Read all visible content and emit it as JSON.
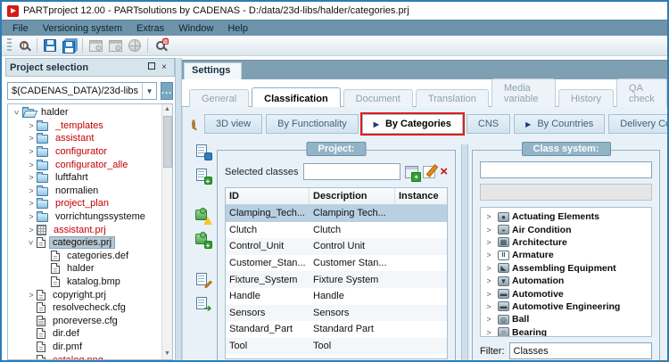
{
  "window": {
    "title": "PARTproject 12.00 - PARTsolutions by CADENAS - D:/data/23d-libs/halder/categories.prj"
  },
  "menubar": {
    "items": [
      {
        "label": "File"
      },
      {
        "label": "Versioning system"
      },
      {
        "label": "Extras"
      },
      {
        "label": "Window"
      },
      {
        "label": "Help"
      }
    ]
  },
  "toolbar": {
    "icons": [
      "search-text-icon",
      "save-icon",
      "save-all-icon",
      "project-window-icon",
      "project-window-settings-icon",
      "publish-globe-icon",
      "search-lock-icon"
    ]
  },
  "project_selection": {
    "title": "Project selection",
    "path_value": "$(CADENAS_DATA)/23d-libs",
    "browse_label": "...",
    "tree": [
      {
        "label": "halder",
        "depth": 0,
        "icon": "folder-open",
        "expander": "open",
        "color": "black",
        "selected": false
      },
      {
        "label": "_templates",
        "depth": 1,
        "icon": "folder",
        "expander": "closed",
        "color": "red",
        "selected": false
      },
      {
        "label": "assistant",
        "depth": 1,
        "icon": "folder",
        "expander": "closed",
        "color": "red",
        "selected": false
      },
      {
        "label": "configurator",
        "depth": 1,
        "icon": "folder",
        "expander": "closed",
        "color": "red",
        "selected": false
      },
      {
        "label": "configurator_alle",
        "depth": 1,
        "icon": "folder",
        "expander": "closed",
        "color": "red",
        "selected": false
      },
      {
        "label": "luftfahrt",
        "depth": 1,
        "icon": "folder",
        "expander": "closed",
        "color": "black",
        "selected": false
      },
      {
        "label": "normalien",
        "depth": 1,
        "icon": "folder",
        "expander": "closed",
        "color": "black",
        "selected": false
      },
      {
        "label": "project_plan",
        "depth": 1,
        "icon": "folder",
        "expander": "closed",
        "color": "red",
        "selected": false
      },
      {
        "label": "vorrichtungssysteme",
        "depth": 1,
        "icon": "folder",
        "expander": "closed",
        "color": "black",
        "selected": false
      },
      {
        "label": "assistant.prj",
        "depth": 1,
        "icon": "prj-grid",
        "expander": "closed",
        "color": "red",
        "selected": false
      },
      {
        "label": "categories.prj",
        "depth": 1,
        "icon": "file",
        "expander": "open",
        "color": "black",
        "selected": true
      },
      {
        "label": "categories.def",
        "depth": 2,
        "icon": "file",
        "expander": "none",
        "color": "black",
        "selected": false
      },
      {
        "label": "halder",
        "depth": 2,
        "icon": "file",
        "expander": "none",
        "color": "black",
        "selected": false
      },
      {
        "label": "katalog.bmp",
        "depth": 2,
        "icon": "file",
        "expander": "none",
        "color": "black",
        "selected": false
      },
      {
        "label": "copyright.prj",
        "depth": 1,
        "icon": "file",
        "expander": "closed",
        "color": "black",
        "selected": false
      },
      {
        "label": "resolvecheck.cfg",
        "depth": 1,
        "icon": "file",
        "expander": "none",
        "color": "black",
        "selected": false
      },
      {
        "label": "pnoreverse.cfg",
        "depth": 1,
        "icon": "file-lines",
        "expander": "none",
        "color": "black",
        "selected": false
      },
      {
        "label": "dir.def",
        "depth": 1,
        "icon": "file",
        "expander": "none",
        "color": "black",
        "selected": false
      },
      {
        "label": "dir.pmf",
        "depth": 1,
        "icon": "file",
        "expander": "none",
        "color": "black",
        "selected": false
      },
      {
        "label": "catalog.png",
        "depth": 1,
        "icon": "file",
        "expander": "none",
        "color": "red",
        "selected": false
      }
    ]
  },
  "settings": {
    "dock_tab_label": "Settings",
    "tabs": [
      {
        "label": "General",
        "active": false
      },
      {
        "label": "Classification",
        "active": true
      },
      {
        "label": "Document",
        "active": false
      },
      {
        "label": "Translation",
        "active": false
      },
      {
        "label": "Media variable",
        "active": false
      },
      {
        "label": "History",
        "active": false
      },
      {
        "label": "QA check",
        "active": false
      }
    ],
    "subtabs": [
      {
        "label": "3D view",
        "arrow": false,
        "active": false,
        "highlighted": false
      },
      {
        "label": "By Functionality",
        "arrow": false,
        "active": false,
        "highlighted": false
      },
      {
        "label": "By Categories",
        "arrow": true,
        "active": true,
        "highlighted": true
      },
      {
        "label": "CNS",
        "arrow": false,
        "active": false,
        "highlighted": false
      },
      {
        "label": "By Countries",
        "arrow": true,
        "active": false,
        "highlighted": false
      },
      {
        "label": "Delivery Countries",
        "arrow": false,
        "active": false,
        "highlighted": false
      }
    ],
    "side_icons": [
      "save-document-icon",
      "add-document-icon",
      "plugin-warning-icon",
      "plugin-add-icon",
      "edit-document-icon",
      "export-document-icon"
    ],
    "project_group": {
      "title": "Project:",
      "selected_classes_label": "Selected classes",
      "selected_classes_value": "",
      "table": {
        "columns": {
          "id": "ID",
          "description": "Description",
          "instance": "Instance"
        },
        "rows": [
          {
            "id": "Clamping_Tech...",
            "description": "Clamping Tech...",
            "instance": "",
            "selected": true
          },
          {
            "id": "Clutch",
            "description": "Clutch",
            "instance": "",
            "selected": false
          },
          {
            "id": "Control_Unit",
            "description": "Control Unit",
            "instance": "",
            "selected": false
          },
          {
            "id": "Customer_Stan...",
            "description": "Customer Stan...",
            "instance": "",
            "selected": false
          },
          {
            "id": "Fixture_System",
            "description": "Fixture System",
            "instance": "",
            "selected": false
          },
          {
            "id": "Handle",
            "description": "Handle",
            "instance": "",
            "selected": false
          },
          {
            "id": "Sensors",
            "description": "Sensors",
            "instance": "",
            "selected": false
          },
          {
            "id": "Standard_Part",
            "description": "Standard Part",
            "instance": "",
            "selected": false
          },
          {
            "id": "Tool",
            "description": "Tool",
            "instance": "",
            "selected": false
          }
        ]
      }
    },
    "class_system_group": {
      "title": "Class system:",
      "search_value": "",
      "tree": [
        {
          "label": "Actuating Elements",
          "icon": "actuating-elements",
          "expander": "closed"
        },
        {
          "label": "Air Condition",
          "icon": "air-condition",
          "expander": "closed"
        },
        {
          "label": "Architecture",
          "icon": "architecture",
          "expander": "closed"
        },
        {
          "label": "Armature",
          "icon": "armature",
          "expander": "closed"
        },
        {
          "label": "Assembling Equipment",
          "icon": "assembling-equipment",
          "expander": "closed"
        },
        {
          "label": "Automation",
          "icon": "automation",
          "expander": "closed"
        },
        {
          "label": "Automotive",
          "icon": "automotive",
          "expander": "closed"
        },
        {
          "label": "Automotive Engineering",
          "icon": "automotive-engineering",
          "expander": "closed"
        },
        {
          "label": "Ball",
          "icon": "ball",
          "expander": "closed"
        },
        {
          "label": "Bearing",
          "icon": "bearing",
          "expander": "closed"
        }
      ],
      "filter_label": "Filter:",
      "filter_value": "Classes"
    }
  },
  "colors": {
    "window_border": "#2f7cb5",
    "menu_bg": "#6d94aa",
    "selection_blue": "#b9d0e2",
    "tree_red": "#c40000",
    "highlight_red": "#e11b1b"
  }
}
